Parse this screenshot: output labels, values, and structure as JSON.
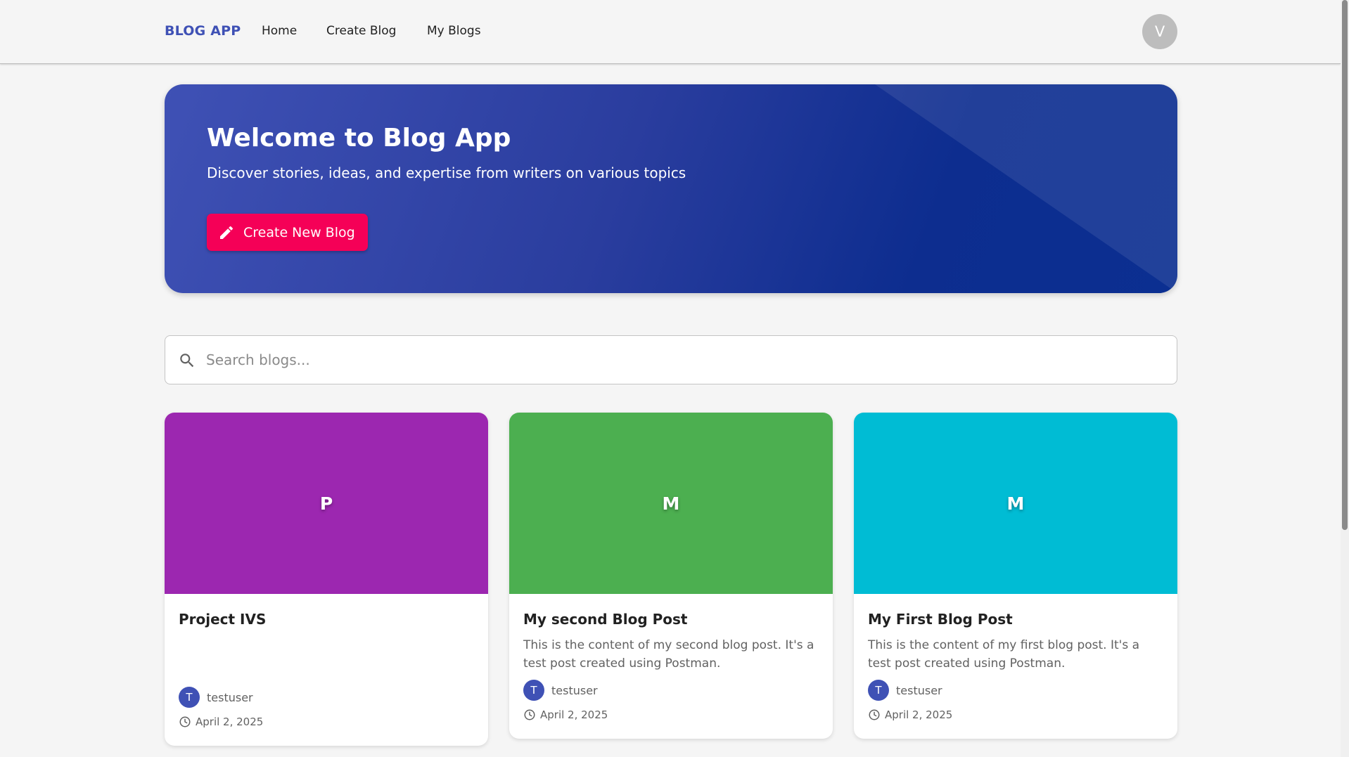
{
  "nav": {
    "brand": "BLOG APP",
    "links": [
      "Home",
      "Create Blog",
      "My Blogs"
    ],
    "avatar_initial": "V"
  },
  "hero": {
    "title": "Welcome to Blog App",
    "subtitle": "Discover stories, ideas, and expertise from writers on various topics",
    "button_label": "Create New Blog",
    "button_icon": "pencil-icon"
  },
  "search": {
    "placeholder": "Search blogs...",
    "value": "",
    "icon": "search-icon"
  },
  "cards": [
    {
      "initial": "P",
      "color": "#9c27b0",
      "title": "Project IVS",
      "excerpt": "",
      "author_initial": "T",
      "author": "testuser",
      "date": "April 2, 2025"
    },
    {
      "initial": "M",
      "color": "#4caf50",
      "title": "My second Blog Post",
      "excerpt": "This is the content of my second blog post. It's a test post created using Postman.",
      "author_initial": "T",
      "author": "testuser",
      "date": "April 2, 2025"
    },
    {
      "initial": "M",
      "color": "#00bcd4",
      "title": "My First Blog Post",
      "excerpt": "This is the content of my first blog post. It's a test post created using Postman.",
      "author_initial": "T",
      "author": "testuser",
      "date": "April 2, 2025"
    }
  ],
  "colors": {
    "primary": "#3f51b5",
    "accent": "#f50057"
  }
}
